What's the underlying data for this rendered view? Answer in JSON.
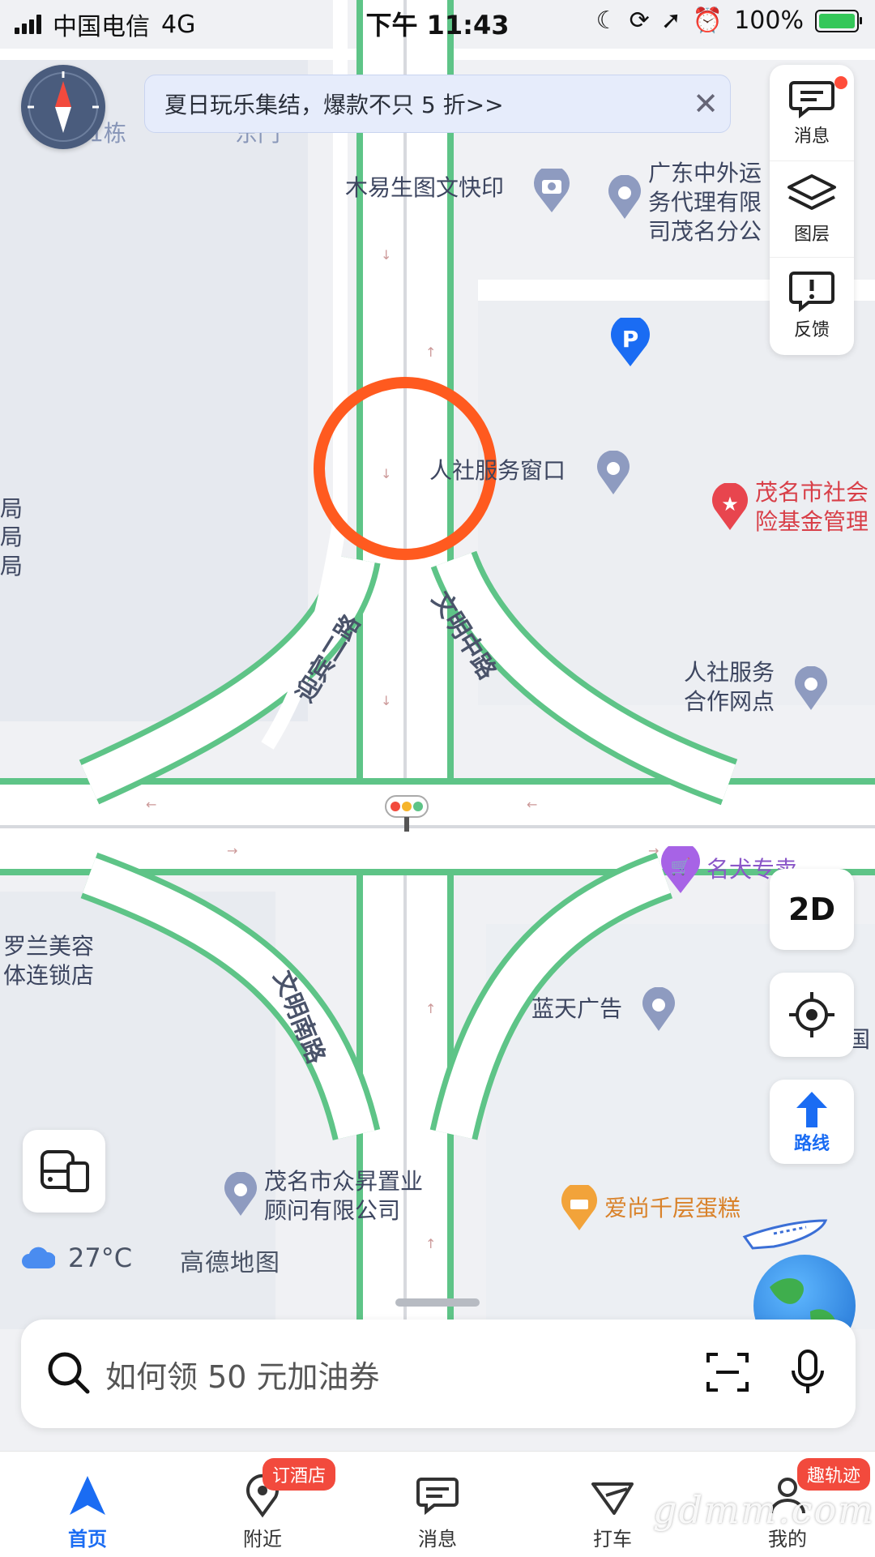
{
  "status_bar": {
    "carrier": "中国电信",
    "network": "4G",
    "time": "下午 11:43",
    "battery": "100%"
  },
  "banner": {
    "text": "夏日玩乐集结，爆款不只 5 折>>",
    "close_icon": "close-icon"
  },
  "right_panel": {
    "items": [
      {
        "label": "消息",
        "icon": "message-icon"
      },
      {
        "label": "图层",
        "icon": "layers-icon"
      },
      {
        "label": "反馈",
        "icon": "feedback-icon"
      }
    ]
  },
  "map": {
    "roads": [
      "迎宾二路",
      "文明中路",
      "文明南路"
    ],
    "pois": [
      {
        "name": "木易生图文快印"
      },
      {
        "name": "广东中外运",
        "line2": "务代理有限",
        "line3": "司茂名分公"
      },
      {
        "name": "人社服务窗口"
      },
      {
        "name": "茂名市社会",
        "line2": "险基金管理"
      },
      {
        "name": "人社服务",
        "line2": "合作网点"
      },
      {
        "name": "名犬专卖"
      },
      {
        "name": "罗兰美容",
        "line2": "体连锁店"
      },
      {
        "name": "蓝天广告"
      },
      {
        "name": "茂名市众昇置业",
        "line2": "顾问有限公司"
      },
      {
        "name": "爱尚千层蛋糕"
      },
      {
        "name": "1栋"
      },
      {
        "name": "东门"
      },
      {
        "name": "局"
      },
      {
        "name": "国"
      }
    ],
    "marker_color": "#ff5a1f",
    "road_edge_color": "#5ec487"
  },
  "controls": {
    "view_mode": "2D",
    "route_label": "路线"
  },
  "weather": {
    "temperature": "27°C"
  },
  "brand": "高德地图",
  "search": {
    "placeholder": "如何领 50 元加油券"
  },
  "tabs": [
    {
      "label": "首页",
      "icon": "navigation-arrow-icon",
      "active": true
    },
    {
      "label": "附近",
      "icon": "location-pin-icon",
      "badge": "订酒店"
    },
    {
      "label": "消息",
      "icon": "message-icon"
    },
    {
      "label": "打车",
      "icon": "taxi-icon"
    },
    {
      "label": "我的",
      "icon": "profile-icon",
      "badge": "趣轨迹"
    }
  ],
  "watermark": "gdmm.com"
}
